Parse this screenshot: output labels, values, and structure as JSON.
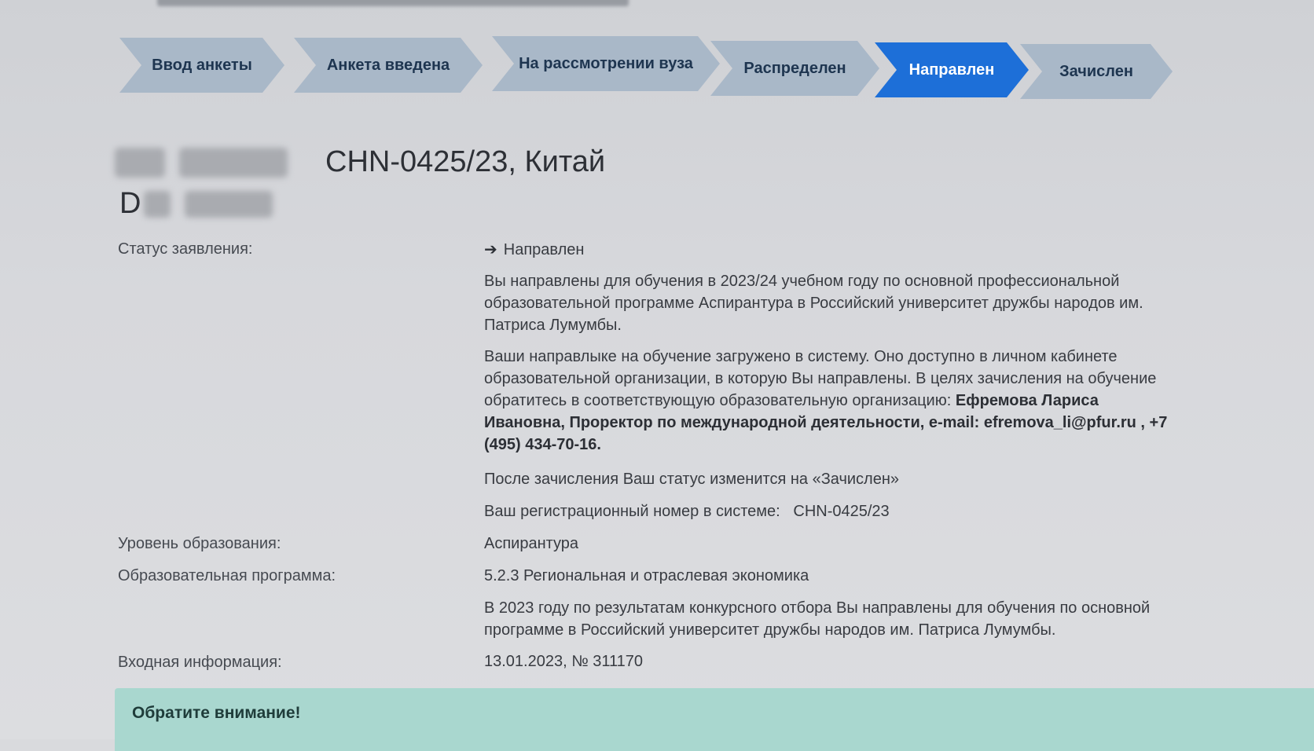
{
  "steps": [
    {
      "label": "Ввод анкеты",
      "active": false
    },
    {
      "label": "Анкета введена",
      "active": false
    },
    {
      "label": "На рассмотрении вуза",
      "active": false
    },
    {
      "label": "Распределен",
      "active": false
    },
    {
      "label": "Направлен",
      "active": true
    },
    {
      "label": "Зачислен",
      "active": false
    }
  ],
  "header": {
    "registration": "CHN-0425/23, Китай",
    "name_initial": "D"
  },
  "details": {
    "status_label": "Статус заявления:",
    "status_value": "Направлен",
    "status_p1": "Вы направлены для обучения в 2023/24 учебном году по основной профессиональной образовательной программе Аспирантура в Российский университет дружбы народов им. Патриса Лумумбы.",
    "status_p2_text": "Ваши направлыке на обучение загружено в систему. Оно доступно в личном кабинете образовательной организации, в которую Вы направлены. В целях зачисления на обучение обратитесь в соответствующую образовательную организацию:",
    "status_p2_contact": "Ефремова Лариса Ивановна, Проректор по международной деятельности, e-mail: efremova_li@pfur.ru , +7 (495) 434-70-16.",
    "status_p3": "После зачисления Ваш статус изменится на «Зачислен»",
    "status_p4_label": "Ваш регистрационный номер в системе:",
    "status_p4_value": "CHN-0425/23",
    "level_label": "Уровень образования:",
    "level_value": "Аспирантура",
    "program_label": "Образовательная программа:",
    "program_value": "5.2.3 Региональная и отраслевая экономика",
    "program_note": "В 2023 году по результатам конкурсного отбора Вы направлены для обучения по основной программе в Российский университет дружбы народов им. Патриса Лумумбы.",
    "incoming_label": "Входная информация:",
    "incoming_value": "13.01.2023, № 311170"
  },
  "notice": {
    "title": "Обратите внимание!"
  }
}
